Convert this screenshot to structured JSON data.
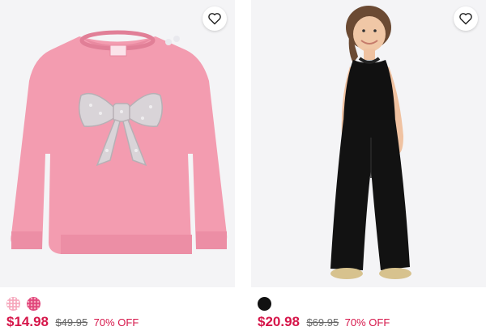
{
  "products": [
    {
      "image_alt": "sweater-image",
      "swatches": [
        {
          "color": "#f6a9bd",
          "pattern": "speckle"
        },
        {
          "color": "#e0467c",
          "pattern": "speckle"
        }
      ],
      "price": "$14.98",
      "original_price": "$49.95",
      "discount": "70% OFF",
      "favorite_icon": "heart-outline-icon"
    },
    {
      "image_alt": "jumpsuit-image",
      "swatches": [
        {
          "color": "#111111",
          "pattern": "solid"
        }
      ],
      "price": "$20.98",
      "original_price": "$69.95",
      "discount": "70% OFF",
      "favorite_icon": "heart-outline-icon"
    }
  ],
  "colors": {
    "price": "#d6164a",
    "strikethrough": "#666666",
    "image_bg": "#f4f4f6"
  }
}
